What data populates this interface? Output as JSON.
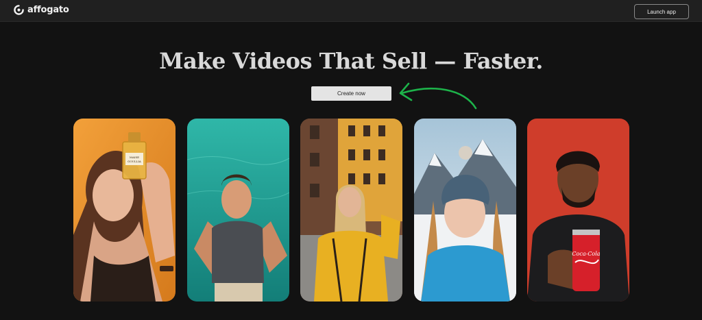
{
  "header": {
    "brand": "affogato",
    "logo_icon": "affogato-logo-icon",
    "launch_label": "Launch app"
  },
  "hero": {
    "title": "Make Videos That Sell — Faster.",
    "cta_label": "Create now",
    "arrow_icon": "curved-arrow-icon",
    "arrow_color": "#1db34a"
  },
  "gallery": {
    "cards": [
      {
        "subject": "woman holding perfume bottle",
        "bg": "#e8952a",
        "product_text": "MAISE GOULLIA"
      },
      {
        "subject": "man taking selfie by the sea",
        "bg": "#1fa79a"
      },
      {
        "subject": "woman in yellow jacket on city street",
        "bg": "#b56a3a"
      },
      {
        "subject": "woman in beanie in snowy mountains",
        "bg": "#9bb5c8"
      },
      {
        "subject": "man holding cola can",
        "bg": "#d2402e",
        "product_text": "Coca-Cola"
      }
    ]
  },
  "colors": {
    "background": "#121212",
    "topbar": "#202020",
    "headline": "#d9d9d9",
    "button": "#e4e4e4"
  }
}
